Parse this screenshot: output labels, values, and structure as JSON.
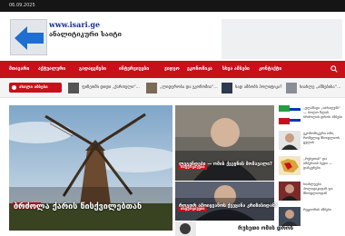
{
  "topbar": {
    "date": "06.09.2025"
  },
  "header": {
    "url": "www.isari.ge",
    "tagline": "ანალიტიკური საიტი"
  },
  "nav": {
    "items": [
      "მთავარი",
      "აქტუალური",
      "გადაცემები",
      "ინტერვიუები",
      "ვიდეო",
      "ეკონომიკა",
      "სხვა ამბები",
      "კონტაქტი"
    ],
    "search_icon": "search-icon"
  },
  "ticker": {
    "label": "ახალი ამბები",
    "items": [
      "ფინეთში დიდი „ქართული“...",
      "„ლიდერობა და ეკონომია“...",
      "სად ამბობს პოლიტიკა?",
      "სიახლე „ამბებისა“..."
    ]
  },
  "hero": {
    "category": "ისტორიული",
    "title": "ბრძოლა ქარის წისქვილებთან"
  },
  "mid_cards": [
    {
      "category": "ინტერვიუები",
      "title": "ლეგენდები — ომის ქვეყნის მომავალი?"
    },
    {
      "category": "ინტერვიუები",
      "title": "როგორ ამოიყვანოს ქვეყანა კრიზისიდან?"
    }
  ],
  "side_items": [
    {
      "title": "„ულამატი „იარაღებს“ — ბოლო წლის ბრძოლის დროს ამბები"
    },
    {
      "title": "ეკონომიკური ომი, რომელიც მსოფლიოს ცვლის"
    },
    {
      "title": "„რუსეთის“ და იმპერიის ბედი — დასკვნები"
    },
    {
      "title": "სიახლეები პოლიტიკიდან და მსოფლიოდან"
    },
    {
      "title": "რეგიონის ამბები"
    }
  ],
  "bottom": {
    "title": "რუსეთი ომის დროს"
  },
  "colors": {
    "accent": "#c8101b",
    "topbar": "#151515",
    "link": "#1a2e8f"
  }
}
